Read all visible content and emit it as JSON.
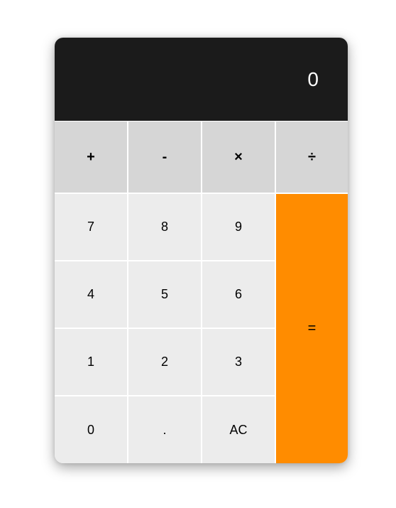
{
  "display": {
    "value": "0"
  },
  "operators": [
    "+",
    "-",
    "×",
    "÷"
  ],
  "keypad": {
    "rows": [
      [
        "7",
        "8",
        "9"
      ],
      [
        "4",
        "5",
        "6"
      ],
      [
        "1",
        "2",
        "3"
      ],
      [
        "0",
        ".",
        "AC"
      ]
    ],
    "equals": "="
  },
  "colors": {
    "display_bg": "#1b1b1b",
    "operator_bg": "#d6d6d6",
    "number_bg": "#ececec",
    "equals_bg": "#ff8c00"
  }
}
